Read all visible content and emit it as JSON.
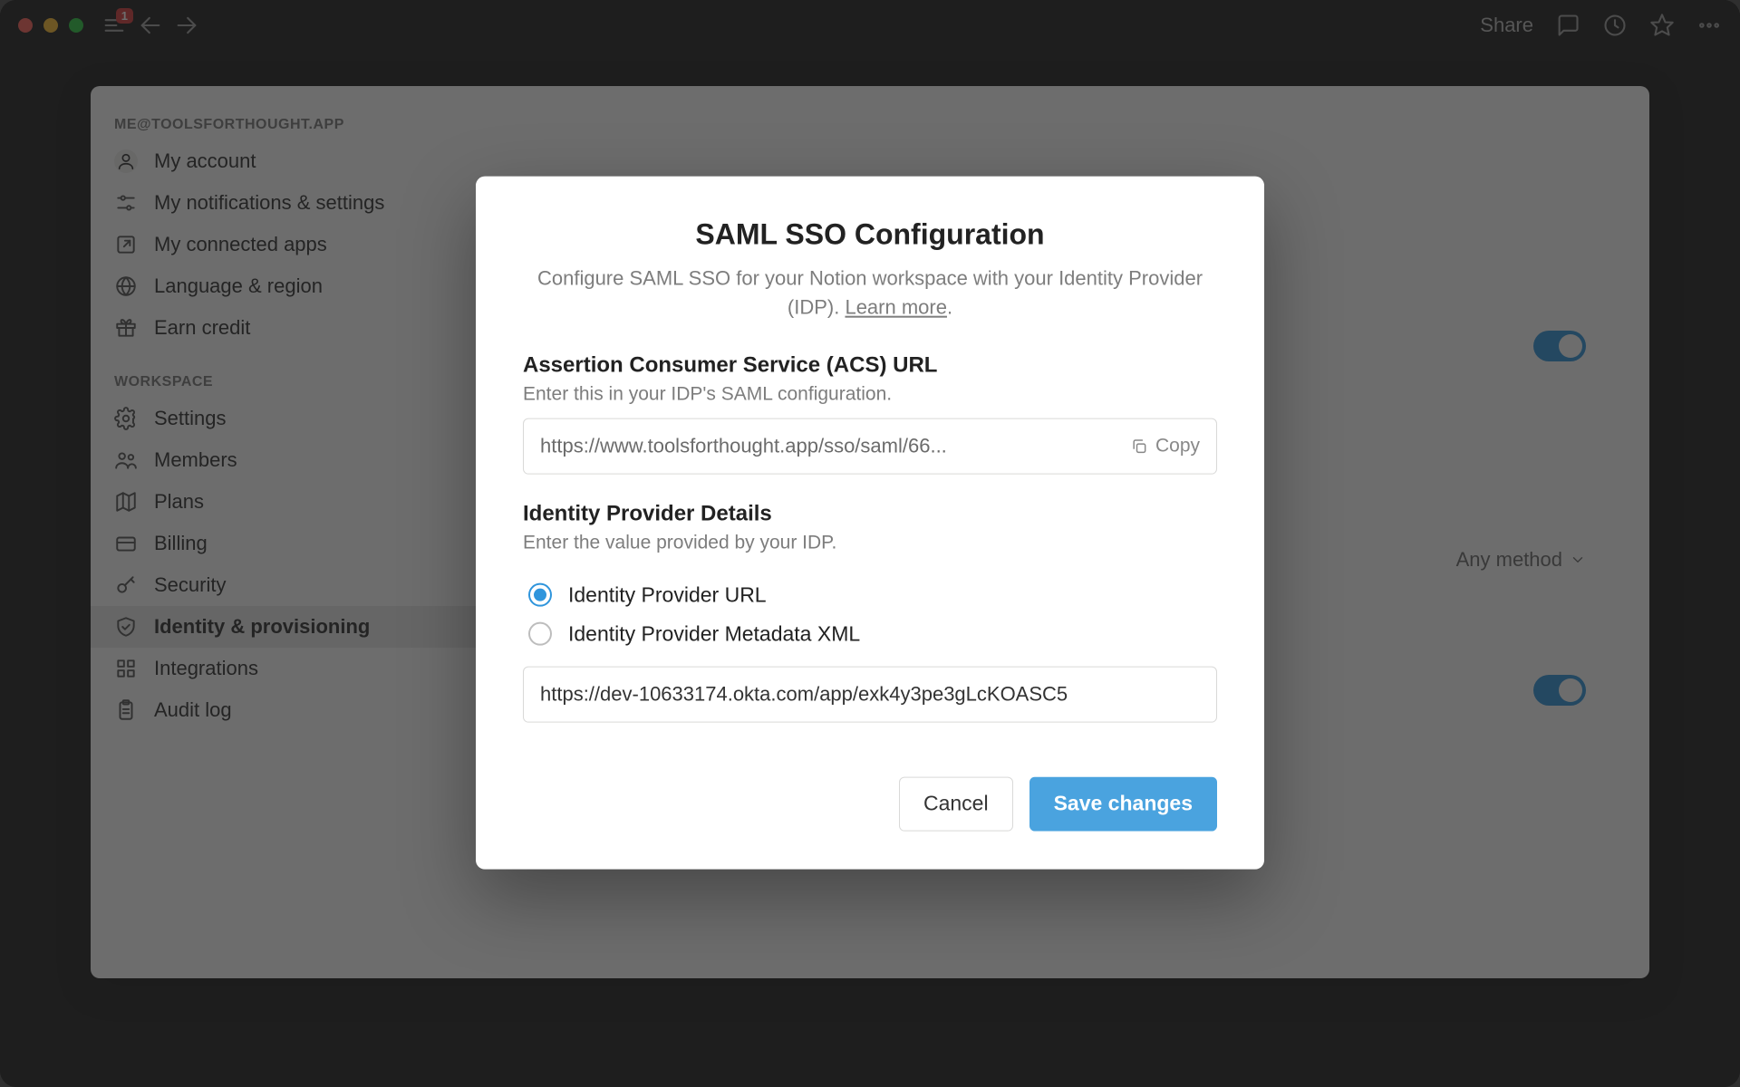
{
  "titlebar": {
    "badge_count": "1",
    "share_label": "Share"
  },
  "sidebar": {
    "account_section": "ME@TOOLSFORTHOUGHT.APP",
    "workspace_section": "WORKSPACE",
    "items_account": [
      {
        "label": "My account",
        "icon": "avatar-icon"
      },
      {
        "label": "My notifications & settings",
        "icon": "sliders-icon"
      },
      {
        "label": "My connected apps",
        "icon": "external-link-icon"
      },
      {
        "label": "Language & region",
        "icon": "globe-icon"
      },
      {
        "label": "Earn credit",
        "icon": "gift-icon"
      }
    ],
    "items_workspace": [
      {
        "label": "Settings",
        "icon": "gear-icon"
      },
      {
        "label": "Members",
        "icon": "people-icon"
      },
      {
        "label": "Plans",
        "icon": "map-icon"
      },
      {
        "label": "Billing",
        "icon": "credit-card-icon"
      },
      {
        "label": "Security",
        "icon": "key-icon"
      },
      {
        "label": "Identity & provisioning",
        "icon": "shield-icon",
        "active": true
      },
      {
        "label": "Integrations",
        "icon": "grid-icon"
      },
      {
        "label": "Audit log",
        "icon": "clipboard-icon"
      }
    ]
  },
  "content": {
    "method_label": "Any method"
  },
  "modal": {
    "title": "SAML SSO Configuration",
    "subtitle_a": "Configure SAML SSO for your Notion workspace with your Identity Provider (IDP). ",
    "learn_more": "Learn more",
    "acs_heading": "Assertion Consumer Service (ACS) URL",
    "acs_hint": "Enter this in your IDP's SAML configuration.",
    "acs_value": "https://www.toolsforthought.app/sso/saml/66...",
    "copy_label": "Copy",
    "idp_heading": "Identity Provider Details",
    "idp_hint": "Enter the value provided by your IDP.",
    "radio_url": "Identity Provider URL",
    "radio_xml": "Identity Provider Metadata XML",
    "idp_value": "https://dev-10633174.okta.com/app/exk4y3pe3gLcKOASC5",
    "cancel": "Cancel",
    "save": "Save changes"
  }
}
